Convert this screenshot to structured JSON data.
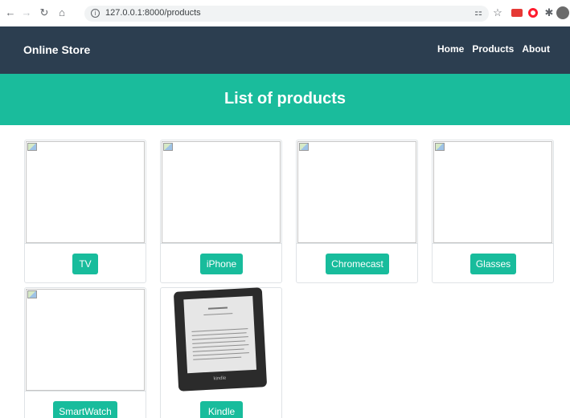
{
  "browser": {
    "url": "127.0.0.1:8000/products"
  },
  "navbar": {
    "brand": "Online Store",
    "links": [
      "Home",
      "Products",
      "About"
    ]
  },
  "hero": {
    "title": "List of products"
  },
  "products": [
    {
      "name": "TV"
    },
    {
      "name": "iPhone"
    },
    {
      "name": "Chromecast"
    },
    {
      "name": "Glasses"
    },
    {
      "name": "SmartWatch"
    },
    {
      "name": "Kindle"
    }
  ],
  "colors": {
    "navbar": "#2c3e50",
    "accent": "#1abc9c",
    "button": "#18bc9c"
  }
}
